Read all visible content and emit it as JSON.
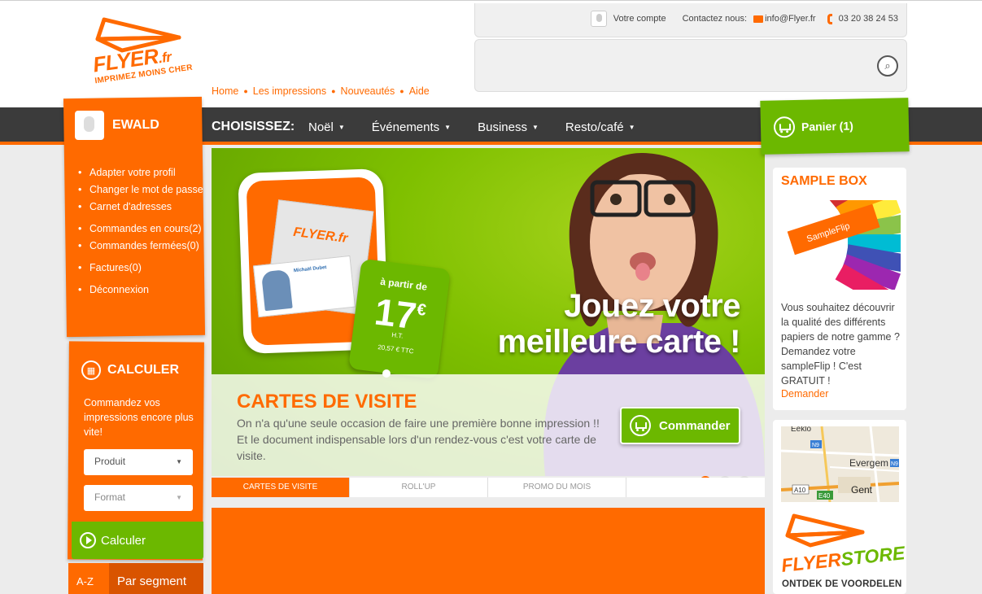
{
  "logo": {
    "brand": "FLYER",
    "tld": ".fr",
    "tagline": "IMPRIMEZ MOINS CHER"
  },
  "breadcrumbs": [
    "Home",
    "Les impressions",
    "Nouveautés",
    "Aide"
  ],
  "topbar": {
    "account": "Votre compte",
    "contact_label": "Contactez nous:",
    "email": "info@Flyer.fr",
    "phone": "03 20 38 24 53"
  },
  "search": {
    "placeholder": "",
    "icon": "search-icon"
  },
  "nav": {
    "label": "CHOISISSEZ:",
    "items": [
      "Noël",
      "Événements",
      "Business",
      "Resto/café"
    ]
  },
  "cart": {
    "label": "Panier (1)"
  },
  "user": {
    "name": "EWALD",
    "menu": [
      "Adapter votre profil",
      "Changer le mot de passe",
      "Carnet d'adresses",
      "Commandes en cours(2)",
      "Commandes fermées(0)",
      "Factures(0)",
      "Déconnexion"
    ]
  },
  "calc": {
    "title": "CALCULER",
    "text": "Commandez vos impressions encore plus vite!",
    "product_placeholder": "Produit",
    "format_placeholder": "Format",
    "button": "Calculer"
  },
  "filter_tabs": {
    "az": "A-Z",
    "segment": "Par segment"
  },
  "banner": {
    "headline_line1": "Jouez votre",
    "headline_line2": "meilleure carte !",
    "price_from": "à partir de",
    "price": "17",
    "currency": "€",
    "price_ht": "H.T.",
    "price_ttc": "20,57 € TTC",
    "card_logo": "FLYER.fr",
    "card_name": "Michaël Dubet",
    "category_title": "CARTES DE VISITE",
    "category_desc": "On n'a qu'une seule occasion de faire une première bonne impression !! Et le document indispensable lors d'un rendez-vous c'est votre carte de visite.",
    "order_button": "Commander",
    "active_slide": 1,
    "slide_count": 3
  },
  "slider_tabs": [
    "CARTES DE VISITE",
    "ROLL'UP",
    "PROMO DU MOIS",
    ""
  ],
  "sample_box": {
    "title": "SAMPLE BOX",
    "fan_label": "SampleFlip",
    "text": "Vous souhaitez découvrir la qualité des différents papiers de notre gamme ? Demandez votre sampleFlip ! C'est GRATUIT !",
    "link": "Demander"
  },
  "map": {
    "labels": [
      "Eeklo",
      "N9",
      "Evergem",
      "N9",
      "A10",
      "E40",
      "Gent"
    ]
  },
  "store": {
    "name_part1": "FLYER",
    "name_part2": "STORE",
    "text": "ONTDEK DE VOORDELEN"
  },
  "colors": {
    "orange": "#ff6a00",
    "green": "#6cb800",
    "dark": "#3b3b3b"
  }
}
